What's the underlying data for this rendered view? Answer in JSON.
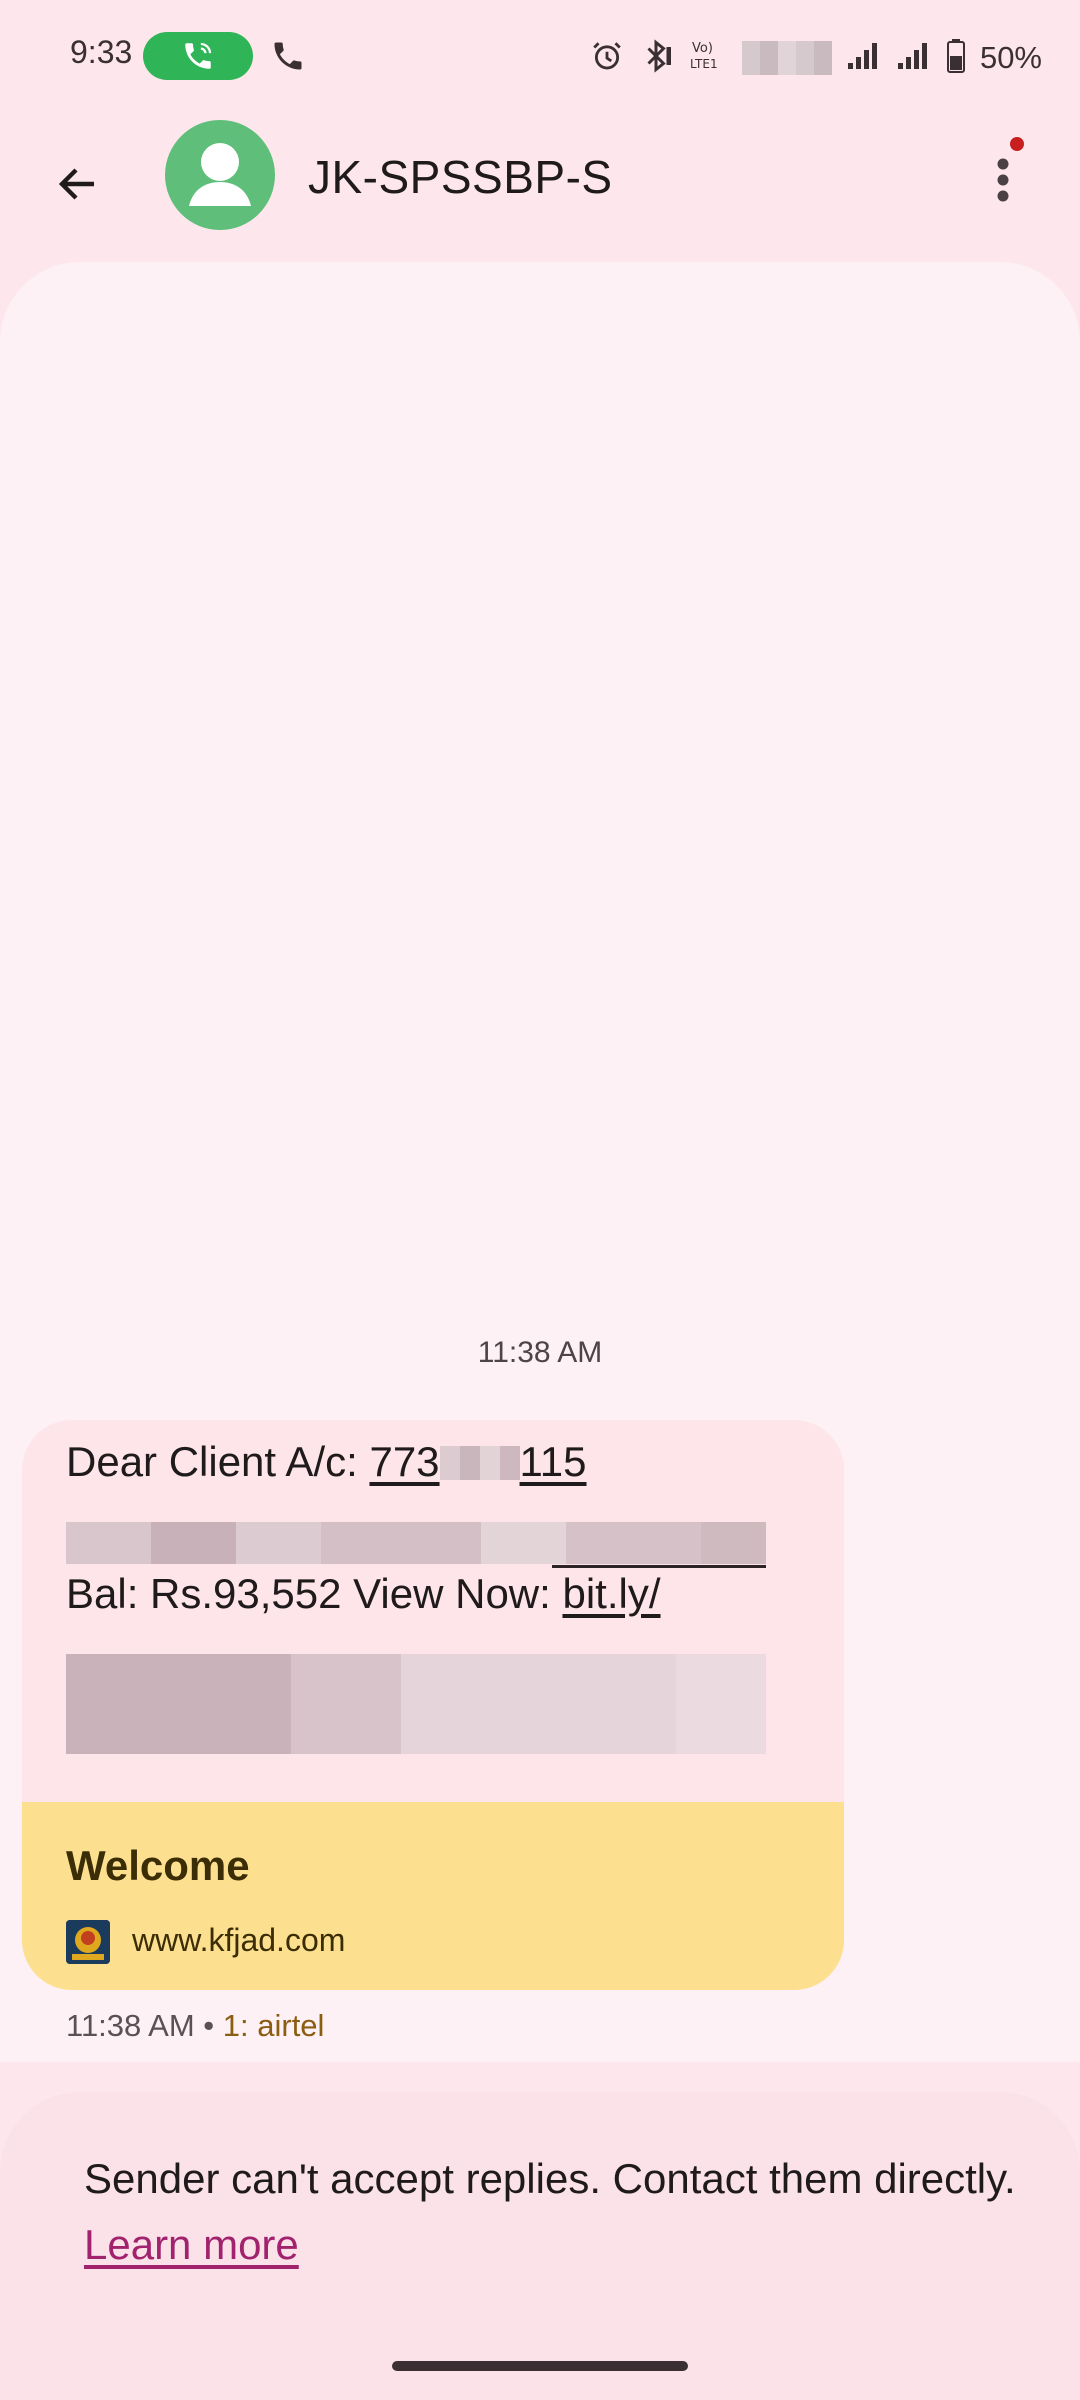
{
  "status_bar": {
    "time": "9:33",
    "battery_text": "50%",
    "icons": [
      "call-in-progress-icon",
      "phone-icon",
      "alarm-icon",
      "bluetooth-icon",
      "volte-icon",
      "signal-icon",
      "battery-icon"
    ]
  },
  "header": {
    "title": "JK-SPSSBP-S",
    "back_icon": "arrow-back-icon",
    "avatar_icon": "person-icon",
    "more_icon": "more-vert-icon"
  },
  "conversation": {
    "date_separator": "11:38 AM",
    "message": {
      "line1_prefix": "Dear Client A/c: ",
      "account_start": "773",
      "account_end": "115",
      "line3_prefix": "Bal: Rs.93,552 View Now: ",
      "link_text": "bit.ly/",
      "preview_title": "Welcome",
      "preview_url": "www.kfjad.com",
      "time": "11:38 AM",
      "separator": " • ",
      "carrier": "1: airtel"
    }
  },
  "footer": {
    "notice_text": "Sender can't accept replies. Contact them directly. ",
    "learn_more": "Learn more"
  },
  "colors": {
    "background": "#fde7ec",
    "sheet": "#fdf1f5",
    "bubble": "#fde5ea",
    "preview": "#fde08f",
    "avatar": "#5fbf7a",
    "call_pill": "#2fb457",
    "link": "#a1236e"
  }
}
